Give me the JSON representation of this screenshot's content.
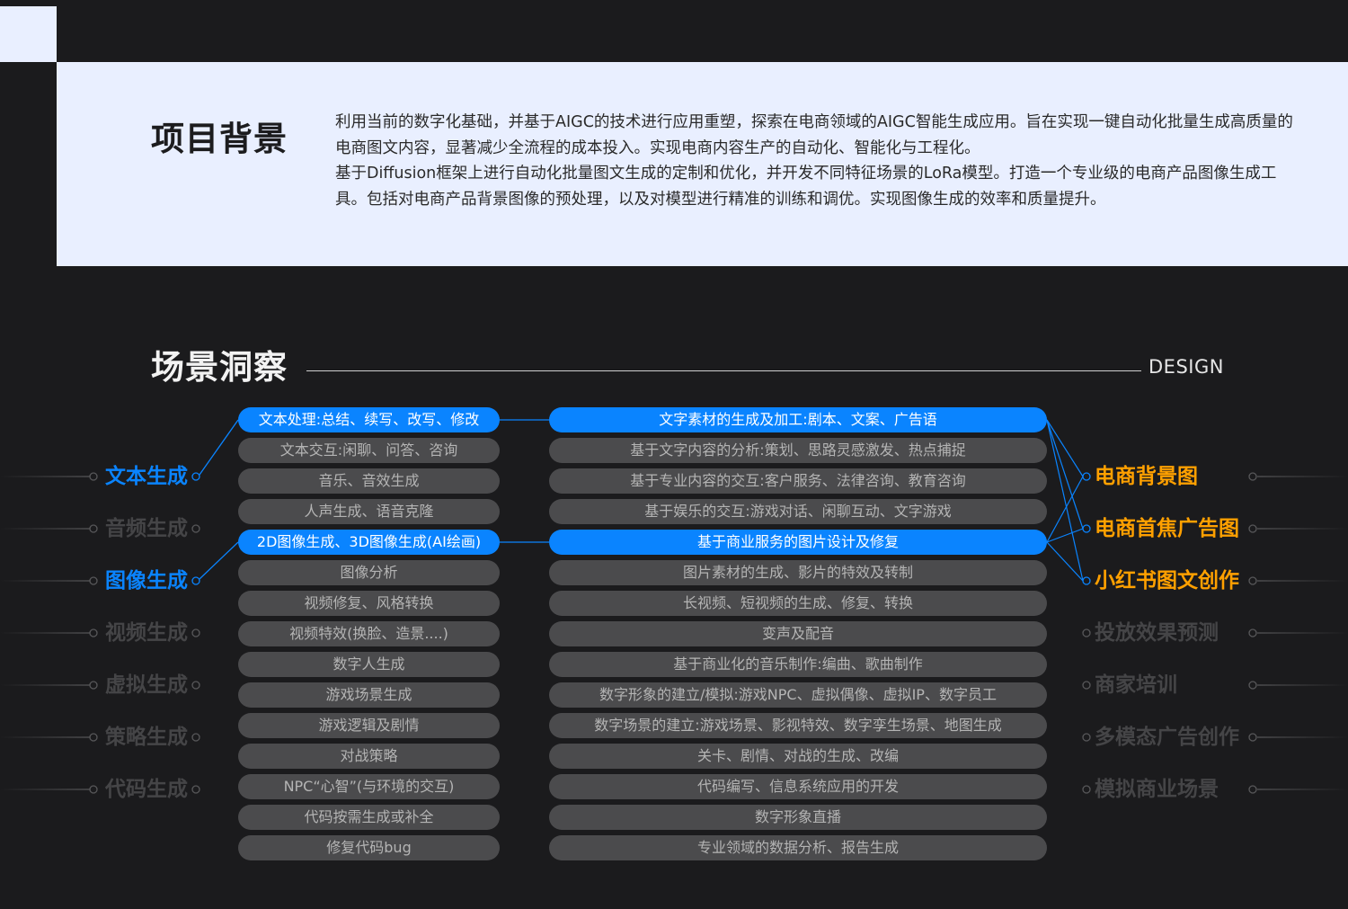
{
  "background_section": {
    "title": "项目背景",
    "paragraph1": "利用当前的数字化基础，并基于AIGC的技术进行应用重塑，探索在电商领域的AIGC智能生成应用。旨在实现一键自动化批量生成高质量的电商图文内容，显著减少全流程的成本投入。实现电商内容生产的自动化、智能化与工程化。",
    "paragraph2": "基于Diffusion框架上进行自动化批量图文生成的定制和优化，并开发不同特征场景的LoRa模型。打造一个专业级的电商产品图像生成工具。包括对电商产品背景图像的预处理，以及对模型进行精准的训练和调优。实现图像生成的效率和质量提升。"
  },
  "insight_section": {
    "title": "场景洞察",
    "design_label": "DESIGN"
  },
  "left_categories": [
    "文本生成",
    "音频生成",
    "图像生成",
    "视频生成",
    "虚拟生成",
    "策略生成",
    "代码生成"
  ],
  "left_items": [
    "文本处理:总结、续写、改写、修改",
    "文本交互:闲聊、问答、咨询",
    "音乐、音效生成",
    "人声生成、语音克隆",
    "2D图像生成、3D图像生成(AI绘画)",
    "图像分析",
    "视频修复、风格转换",
    "视频特效(换脸、造景....)",
    "数字人生成",
    "游戏场景生成",
    "游戏逻辑及剧情",
    "对战策略",
    "NPC“心智”(与环境的交互)",
    "代码按需生成或补全",
    "修复代码bug"
  ],
  "middle_items": [
    "文字素材的生成及加工:剧本、文案、广告语",
    "基于文字内容的分析:策划、思路灵感激发、热点捕捉",
    "基于专业内容的交互:客户服务、法律咨询、教育咨询",
    "基于娱乐的交互:游戏对话、闲聊互动、文字游戏",
    "基于商业服务的图片设计及修复",
    "图片素材的生成、影片的特效及转制",
    "长视频、短视频的生成、修复、转换",
    "变声及配音",
    "基于商业化的音乐制作:编曲、歌曲制作",
    "数字形象的建立/模拟:游戏NPC、虚拟偶像、虚拟IP、数字员工",
    "数字场景的建立:游戏场景、影视特效、数字孪生场景、地图生成",
    "关卡、剧情、对战的生成、改编",
    "代码编写、信息系统应用的开发",
    "数字形象直播",
    "专业领域的数据分析、报告生成"
  ],
  "right_categories": [
    "电商背景图",
    "电商首焦广告图",
    "小红书图文创作",
    "投放效果预测",
    "商家培训",
    "多模态广告创作",
    "模拟商业场景"
  ],
  "highlights": {
    "left_categories": [
      0,
      2
    ],
    "left_items": [
      0,
      4
    ],
    "middle_items": [
      0,
      4
    ],
    "right_categories": [
      0,
      1,
      2
    ]
  },
  "colors": {
    "blue": "#0a84ff",
    "orange": "#ffa000",
    "pill_gray": "#4b4b4d",
    "inactive_text": "#454547",
    "panel": "#e9efff",
    "background": "#1b1b1d"
  }
}
